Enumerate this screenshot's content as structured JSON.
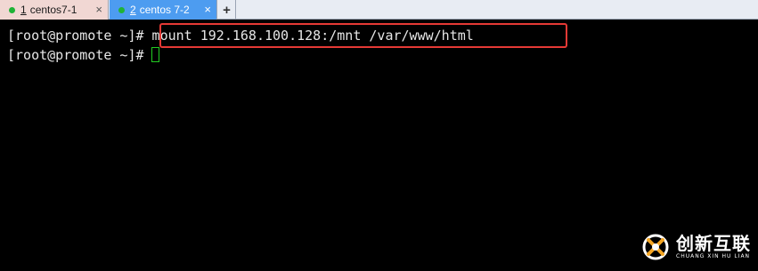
{
  "tabs": [
    {
      "number": "1",
      "label": "centos7-1",
      "close": "×",
      "active": false
    },
    {
      "number": "2",
      "label": "centos 7-2",
      "close": "×",
      "active": true
    }
  ],
  "new_tab_label": "+",
  "terminal": {
    "lines": [
      {
        "prompt": "[root@promote ~]#",
        "command": " mount 192.168.100.128:/mnt /var/www/html"
      },
      {
        "prompt": "[root@promote ~]#",
        "command": ""
      }
    ]
  },
  "watermark": {
    "main": "创新互联",
    "sub": "CHUANG XIN HU LIAN"
  },
  "colors": {
    "terminal_bg": "#000000",
    "terminal_fg": "#e6e6e6",
    "highlight": "#e53935",
    "cursor": "#22cc22",
    "active_tab": "#4d9cf0",
    "inactive_tab": "#f1d7d3",
    "status_dot": "#1fb336"
  }
}
